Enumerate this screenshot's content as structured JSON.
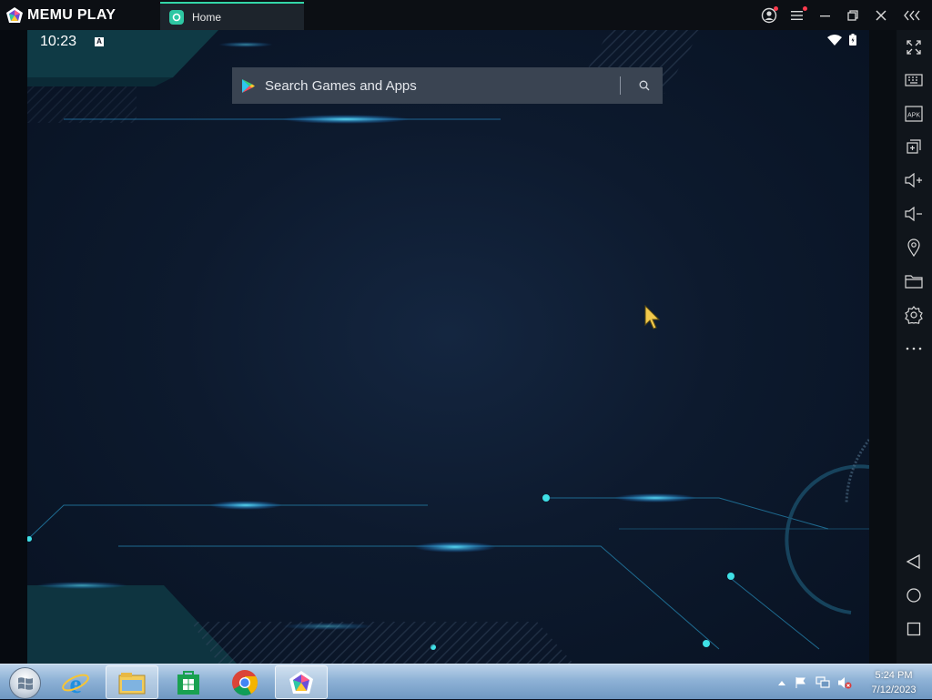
{
  "app": {
    "name": "MEMU PLAY"
  },
  "tab": {
    "label": "Home"
  },
  "android": {
    "status_time": "10:23",
    "search_placeholder": "Search Games and Apps"
  },
  "sidebar": {
    "items": [
      "fullscreen-icon",
      "keyboard-icon",
      "apk-icon",
      "add-window-icon",
      "volume-up-icon",
      "volume-down-icon",
      "location-icon",
      "folder-icon",
      "settings-icon",
      "more-icon",
      "back-icon",
      "home-icon",
      "recents-icon"
    ],
    "apk_text": "APK"
  },
  "taskbar": {
    "apps": [
      "internet-explorer",
      "file-explorer",
      "store",
      "chrome",
      "memu"
    ],
    "time": "5:24 PM",
    "date": "7/12/2023"
  },
  "colors": {
    "accent": "#33d6a8",
    "sidebar_bg": "#10151b",
    "search_bg": "#3a4452"
  }
}
